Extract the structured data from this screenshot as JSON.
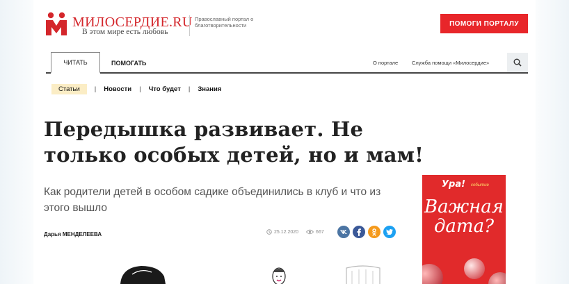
{
  "header": {
    "logo_title": "МИЛОСЕРДИЕ.RU",
    "logo_subtitle": "В этом мире есть любовь",
    "logo_description": "Православный портал о благотворительности",
    "help_button": "ПОМОГИ ПОРТАЛУ"
  },
  "nav": {
    "tab_read": "ЧИТАТЬ",
    "tab_help": "ПОМОГАТЬ",
    "link_about": "О портале",
    "link_service": "Служба помощи «Милосердие»",
    "search_icon": "search-icon"
  },
  "subnav": {
    "items": [
      "Статьи",
      "Новости",
      "Что будет",
      "Знания"
    ],
    "active": "Статьи"
  },
  "article": {
    "title": "Передышка развивает. Не только особых детей, но и мам!",
    "lead": "Как родители детей в особом садике объединились в клуб и что из этого вышло",
    "author": "Дарья МЕНДЕЛЕЕВА",
    "date": "25.12.2020",
    "views": "667",
    "socials": [
      {
        "icon": "vk-icon",
        "label": "vk",
        "color": "#4c75a3"
      },
      {
        "icon": "facebook-icon",
        "label": "f",
        "color": "#3b5998"
      },
      {
        "icon": "odnoklassniki-icon",
        "label": "ok",
        "color": "#f59a1c"
      },
      {
        "icon": "twitter-icon",
        "label": "tw",
        "color": "#1da1f2"
      }
    ]
  },
  "ad": {
    "brand": "Ура!",
    "brand_sub": "событие",
    "headline": "Важная дата?"
  },
  "colors": {
    "brand_red": "#e8262a",
    "subnav_active_bg": "#fbedc5"
  }
}
